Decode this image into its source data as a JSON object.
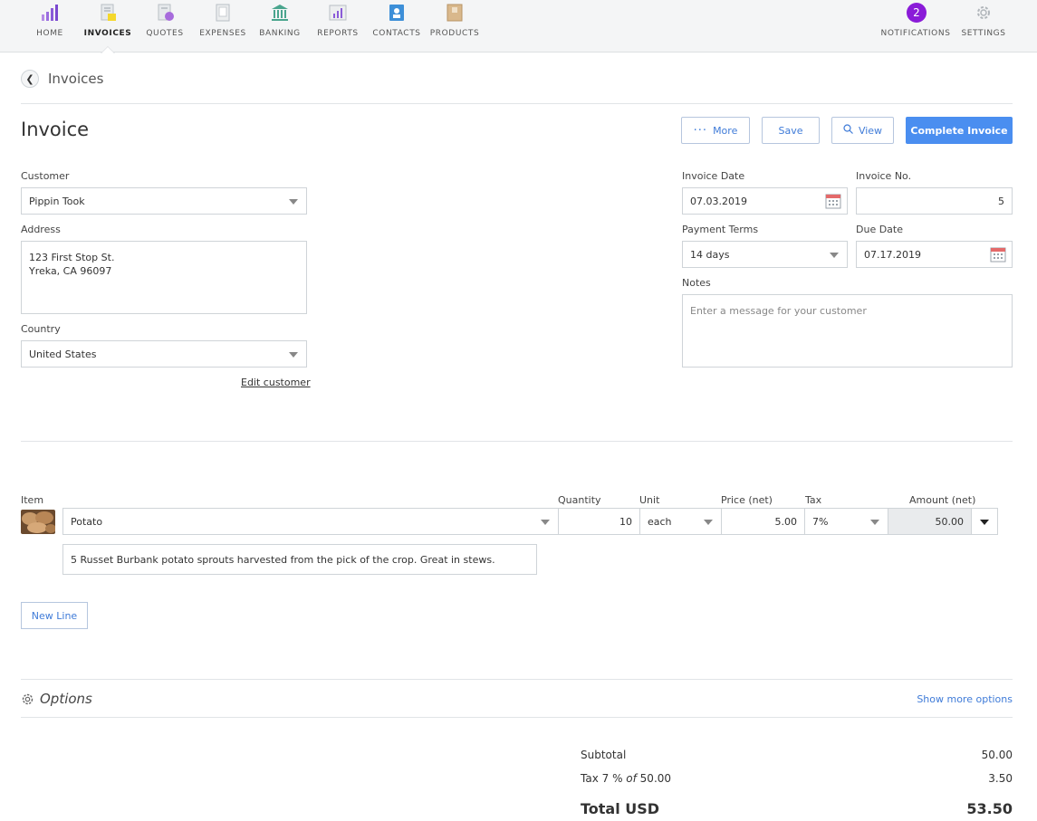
{
  "nav": {
    "items": [
      {
        "label": "HOME",
        "icon": "home-chart-icon"
      },
      {
        "label": "INVOICES",
        "icon": "invoice-doc-icon"
      },
      {
        "label": "QUOTES",
        "icon": "quote-doc-icon"
      },
      {
        "label": "EXPENSES",
        "icon": "expense-doc-icon"
      },
      {
        "label": "BANKING",
        "icon": "bank-icon"
      },
      {
        "label": "REPORTS",
        "icon": "report-icon"
      },
      {
        "label": "CONTACTS",
        "icon": "contacts-book-icon"
      },
      {
        "label": "PRODUCTS",
        "icon": "product-box-icon"
      }
    ],
    "notifications": {
      "label": "NOTIFICATIONS",
      "count": "2"
    },
    "settings": {
      "label": "SETTINGS",
      "icon": "gear-icon"
    }
  },
  "breadcrumb": {
    "label": "Invoices"
  },
  "page": {
    "title": "Invoice"
  },
  "toolbar": {
    "more_label": "More",
    "save_label": "Save",
    "view_label": "View",
    "complete_label": "Complete Invoice"
  },
  "customer": {
    "customer_label": "Customer",
    "customer_value": "Pippin Took",
    "address_label": "Address",
    "address_line1": "123 First Stop St.",
    "address_line2": "Yreka, CA 96097",
    "country_label": "Country",
    "country_value": "United States",
    "edit_link": "Edit customer"
  },
  "invoice_meta": {
    "date_label": "Invoice Date",
    "date_value": "07.03.2019",
    "number_label": "Invoice No.",
    "number_value": "5",
    "terms_label": "Payment Terms",
    "terms_value": "14 days",
    "due_label": "Due Date",
    "due_value": "07.17.2019",
    "notes_label": "Notes",
    "notes_placeholder": "Enter a message for your customer"
  },
  "line_items": {
    "headers": {
      "item": "Item",
      "quantity": "Quantity",
      "unit": "Unit",
      "price": "Price (net)",
      "tax": "Tax",
      "amount": "Amount (net)"
    },
    "rows": [
      {
        "item": "Potato",
        "quantity": "10",
        "unit": "each",
        "price": "5.00",
        "tax": "7%",
        "amount": "50.00",
        "description": "5 Russet Burbank potato sprouts harvested from the pick of the crop. Great in stews."
      }
    ],
    "new_line_label": "New Line"
  },
  "options": {
    "title": "Options",
    "show_more": "Show more options"
  },
  "totals": {
    "subtotal_label": "Subtotal",
    "subtotal_value": "50.00",
    "tax_label_prefix": "Tax 7 % ",
    "tax_label_of": "of",
    "tax_label_base": " 50.00",
    "tax_value": "3.50",
    "total_label": "Total USD",
    "total_value": "53.50"
  },
  "colors": {
    "accent": "#4a8ef0",
    "notification_badge": "#8a1bd8"
  }
}
